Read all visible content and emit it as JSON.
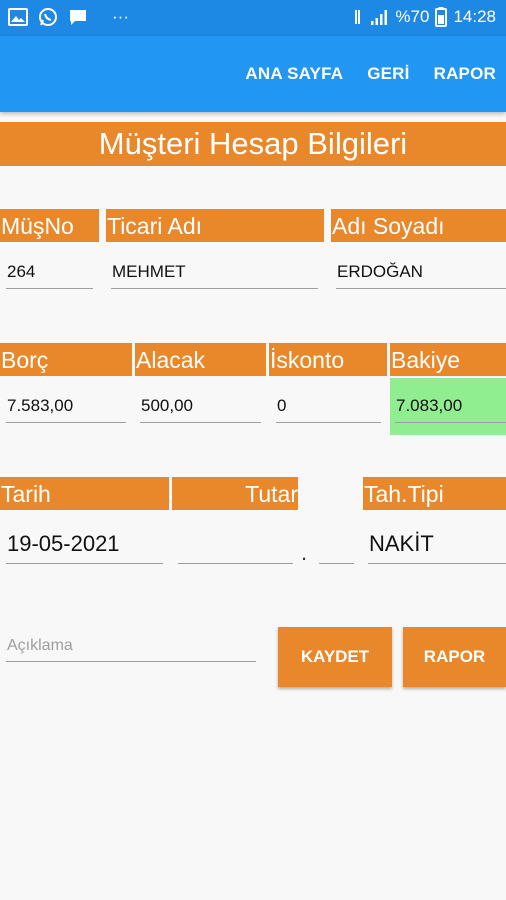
{
  "status": {
    "battery": "%70",
    "time": "14:28",
    "more": "···"
  },
  "appbar": {
    "menu": [
      "ANA SAYFA",
      "GERİ",
      "RAPOR"
    ]
  },
  "title": "Müşteri Hesap Bilgileri",
  "customer": {
    "headers": {
      "no": "MüşNo",
      "trade_name": "Ticari Adı",
      "full_name": "Adı Soyadı"
    },
    "values": {
      "no": "264",
      "trade_name": "MEHMET",
      "full_name": "ERDOĞAN"
    }
  },
  "account": {
    "headers": {
      "debt": "Borç",
      "credit": "Alacak",
      "discount": "İskonto",
      "balance": "Bakiye"
    },
    "values": {
      "debt": "7.583,00",
      "credit": "500,00",
      "discount": "0",
      "balance": "7.083,00"
    }
  },
  "payment": {
    "headers": {
      "date": "Tarih",
      "amount": "Tutar",
      "type": "Tah.Tipi"
    },
    "values": {
      "date": "19-05-2021",
      "amount": "",
      "decimal_separator": ".",
      "decimals": "",
      "type": "NAKİT"
    }
  },
  "note": {
    "placeholder": "Açıklama"
  },
  "buttons": {
    "save": "KAYDET",
    "report": "RAPOR"
  },
  "colors": {
    "accent": "#e8882a",
    "appbar": "#2196f3",
    "balance_bg": "#90ee90"
  }
}
